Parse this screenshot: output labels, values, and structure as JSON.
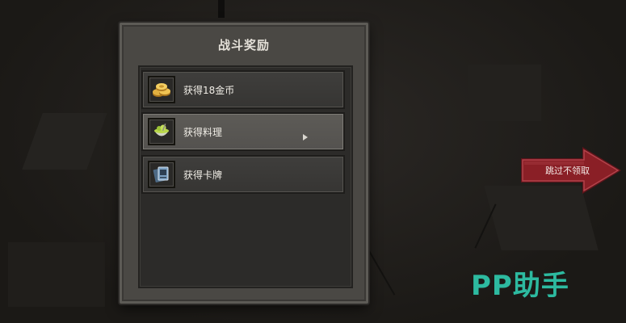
{
  "panel": {
    "title": "战斗奖励"
  },
  "rewards": [
    {
      "label": "获得18金币",
      "icon": "gold-coins-icon",
      "selected": false
    },
    {
      "label": "获得料理",
      "icon": "food-bowl-icon",
      "selected": true
    },
    {
      "label": "获得卡牌",
      "icon": "card-icon",
      "selected": false
    }
  ],
  "skip": {
    "label": "跳过不领取"
  },
  "watermark": {
    "text": "PP助手"
  },
  "colors": {
    "skip_arrow": "#8a1f26",
    "watermark": "#2ec3a8"
  }
}
